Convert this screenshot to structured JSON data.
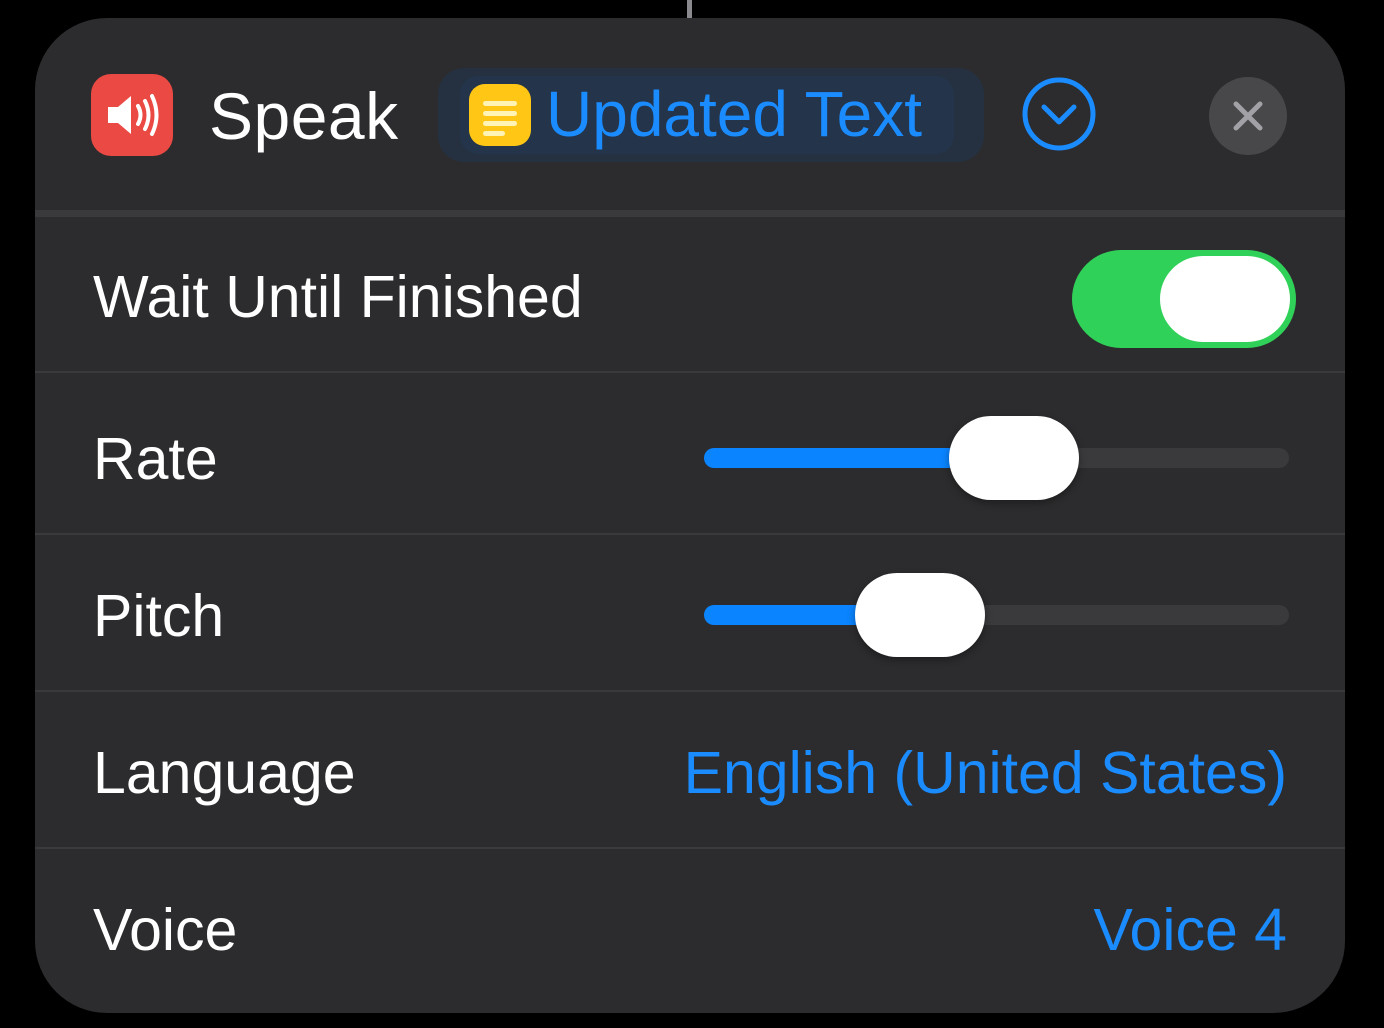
{
  "colors": {
    "background": "#000000",
    "card": "#2c2c2e",
    "accent": "#1a8cff",
    "toggle_on": "#30d158",
    "action_icon": "#ea4a43",
    "variable_icon": "#ffc615"
  },
  "header": {
    "action_icon": "speaker-wave-icon",
    "title": "Speak",
    "variable": {
      "icon": "text-lines-icon",
      "label": "Updated Text"
    },
    "expand_icon": "chevron-down-circle-icon",
    "close_icon": "close-icon"
  },
  "parameters": {
    "wait": {
      "label": "Wait Until Finished",
      "enabled": true
    },
    "rate": {
      "label": "Rate",
      "value_fraction": 0.53
    },
    "pitch": {
      "label": "Pitch",
      "value_fraction": 0.37
    },
    "language": {
      "label": "Language",
      "value": "English (United States)"
    },
    "voice": {
      "label": "Voice",
      "value": "Voice 4"
    }
  }
}
